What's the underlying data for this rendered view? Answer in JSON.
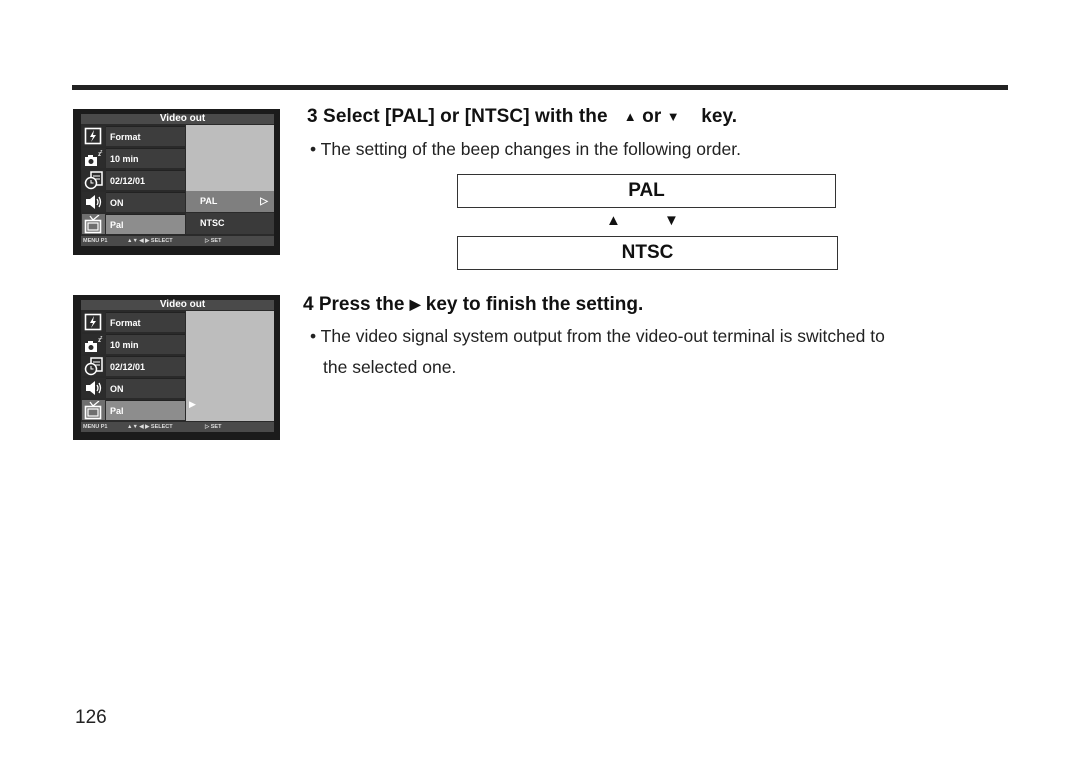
{
  "page_number": "126",
  "screen_before": {
    "title": "Video out",
    "rows": [
      {
        "icon": "format-icon",
        "label": "Format"
      },
      {
        "icon": "sleep-camera-icon",
        "label": "10 min"
      },
      {
        "icon": "clock-date-icon",
        "label": "02/12/01"
      },
      {
        "icon": "speaker-icon",
        "label": "ON"
      },
      {
        "icon": "tv-icon",
        "label": "Pal"
      }
    ],
    "options": [
      {
        "label": "PAL",
        "highlighted": true,
        "arrow": "▷"
      },
      {
        "label": "NTSC",
        "highlighted": false
      }
    ],
    "footer": {
      "menu": "MENU P1",
      "nav": "▲▼  ◀ ▶ SELECT",
      "set": "▷ SET"
    }
  },
  "screen_after": {
    "title": "Video out",
    "rows": [
      {
        "icon": "format-icon",
        "label": "Format"
      },
      {
        "icon": "sleep-camera-icon",
        "label": "10 min"
      },
      {
        "icon": "clock-date-icon",
        "label": "02/12/01"
      },
      {
        "icon": "speaker-icon",
        "label": "ON"
      },
      {
        "icon": "tv-icon",
        "label": "Pal"
      }
    ],
    "pointer": "▶",
    "footer": {
      "menu": "MENU P1",
      "nav": "▲▼  ◀ ▶ SELECT",
      "set": "▷ SET"
    }
  },
  "step3": {
    "heading_pre": "3 Select  [PAL] or [NTSC] with the",
    "up_symbol": "▲",
    "or": "or",
    "down_symbol": "▼",
    "heading_post": "key.",
    "bullet": "•  The setting of the beep changes in the following order.",
    "sequence": [
      "PAL",
      "NTSC"
    ],
    "sequence_up": "▲",
    "sequence_down": "▼"
  },
  "step4": {
    "heading_pre": "4 Press the",
    "right_symbol": "▶",
    "heading_post": "key to finish the setting.",
    "bullet_line1": "•  The video signal system output from the video-out terminal is switched to",
    "bullet_line2": "the selected one."
  }
}
